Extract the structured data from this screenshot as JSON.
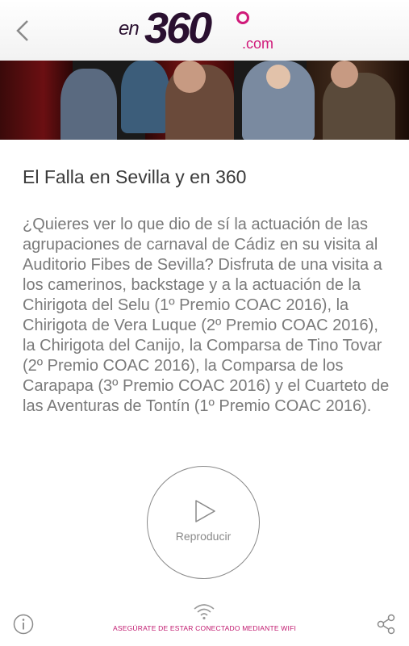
{
  "header": {
    "logo": {
      "prefix": "en",
      "number": "360",
      "suffix": ".com"
    },
    "back_icon": "chevron-left-icon"
  },
  "content": {
    "title": "El Falla en Sevilla y en 360",
    "description": "¿Quieres ver lo que dio de sí la actuación de las agrupaciones de carnaval de Cádiz en su visita al Auditorio Fibes de Sevilla? Disfruta de una visita a los camerinos, backstage y a la actuación de la Chirigota del Selu (1º Premio COAC 2016), la Chirigota de Vera Luque (2º Premio COAC 2016), la Chirigota del Canijo, la Comparsa de Tino Tovar (2º Premio COAC 2016), la Comparsa de los Carapapa (3º Premio COAC 2016) y el Cuarteto de las Aventuras de Tontín (1º Premio COAC 2016)."
  },
  "player": {
    "label": "Reproducir",
    "icon": "play-icon"
  },
  "footer": {
    "info_icon": "info-icon",
    "wifi_icon": "wifi-icon",
    "wifi_warning": "ASEGÚRATE DE ESTAR CONECTADO MEDIANTE WIFI",
    "share_icon": "share-icon"
  },
  "colors": {
    "brand_magenta": "#d01a7a",
    "brand_dark": "#2a1030",
    "warning_text": "#c0186e"
  }
}
